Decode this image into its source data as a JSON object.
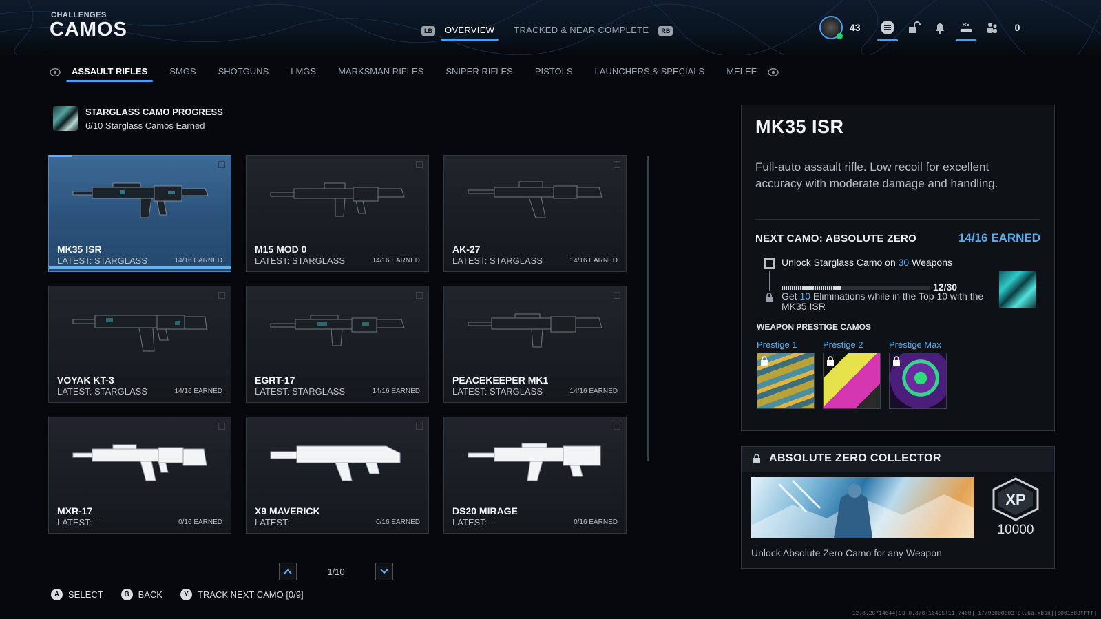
{
  "header": {
    "subtitle": "CHALLENGES",
    "title": "CAMOS"
  },
  "top_tabs": {
    "left_bumper": "LB",
    "right_bumper": "RB",
    "items": [
      {
        "label": "OVERVIEW",
        "active": true
      },
      {
        "label": "TRACKED & NEAR COMPLETE",
        "active": false
      }
    ]
  },
  "hud": {
    "level": "43",
    "right_stick": "RS",
    "count": "0"
  },
  "categories": [
    {
      "label": "ASSAULT RIFLES",
      "active": true
    },
    {
      "label": "SMGS"
    },
    {
      "label": "SHOTGUNS"
    },
    {
      "label": "LMGS"
    },
    {
      "label": "MARKSMAN RIFLES"
    },
    {
      "label": "SNIPER RIFLES"
    },
    {
      "label": "PISTOLS"
    },
    {
      "label": "LAUNCHERS & SPECIALS"
    },
    {
      "label": "MELEE"
    }
  ],
  "progress": {
    "title": "STARGLASS CAMO PROGRESS",
    "subtitle": "6/10 Starglass Camos Earned"
  },
  "weapons": [
    {
      "name": "MK35 ISR",
      "latest": "LATEST: STARGLASS",
      "earned": "14/16 EARNED",
      "selected": true
    },
    {
      "name": "M15 MOD 0",
      "latest": "LATEST: STARGLASS",
      "earned": "14/16 EARNED"
    },
    {
      "name": "AK-27",
      "latest": "LATEST: STARGLASS",
      "earned": "14/16 EARNED"
    },
    {
      "name": "VOYAK KT-3",
      "latest": "LATEST: STARGLASS",
      "earned": "14/16 EARNED"
    },
    {
      "name": "EGRT-17",
      "latest": "LATEST: STARGLASS",
      "earned": "14/16 EARNED"
    },
    {
      "name": "PEACEKEEPER MK1",
      "latest": "LATEST: STARGLASS",
      "earned": "14/16 EARNED"
    },
    {
      "name": "MXR-17",
      "latest": "LATEST: --",
      "earned": "0/16 EARNED"
    },
    {
      "name": "X9 MAVERICK",
      "latest": "LATEST: --",
      "earned": "0/16 EARNED"
    },
    {
      "name": "DS20 MIRAGE",
      "latest": "LATEST: --",
      "earned": "0/16 EARNED"
    }
  ],
  "pager": {
    "text": "1/10"
  },
  "footer": [
    {
      "glyph": "A",
      "label": "SELECT"
    },
    {
      "glyph": "B",
      "label": "BACK"
    },
    {
      "glyph": "Y",
      "label": "TRACK NEXT CAMO [0/9]"
    }
  ],
  "detail": {
    "title": "MK35 ISR",
    "description": "Full-auto assault rifle. Low recoil for excellent accuracy with moderate damage and handling.",
    "next_camo": "NEXT CAMO: ABSOLUTE ZERO",
    "next_earned": "14/16 EARNED",
    "challenge1": {
      "prefix": "Unlock Starglass Camo on ",
      "highlight": "30",
      "suffix": " Weapons"
    },
    "progress": {
      "current": 12,
      "total": 30,
      "text": "12/30"
    },
    "challenge2": {
      "prefix": "Get ",
      "highlight": "10",
      "suffix": " Eliminations while in the Top 10 with the MK35 ISR"
    },
    "prestige_heading": "WEAPON PRESTIGE CAMOS",
    "prestige": [
      {
        "label": "Prestige 1"
      },
      {
        "label": "Prestige 2"
      },
      {
        "label": "Prestige Max"
      }
    ]
  },
  "collector": {
    "title": "ABSOLUTE ZERO COLLECTOR",
    "xp_badge": "XP",
    "xp_value": "10000",
    "description": "Unlock Absolute Zero Camo for any Weapon"
  },
  "debug_text": "12.8.26714644[93-0.878]10405+11[7400][17793000003.pl.6a.xbsx][0001883ffff]",
  "colors": {
    "accent": "#3fa0ff",
    "highlight_text": "#54aef5",
    "selected_card": "#2f5d8a",
    "panel": "#0e1217"
  }
}
